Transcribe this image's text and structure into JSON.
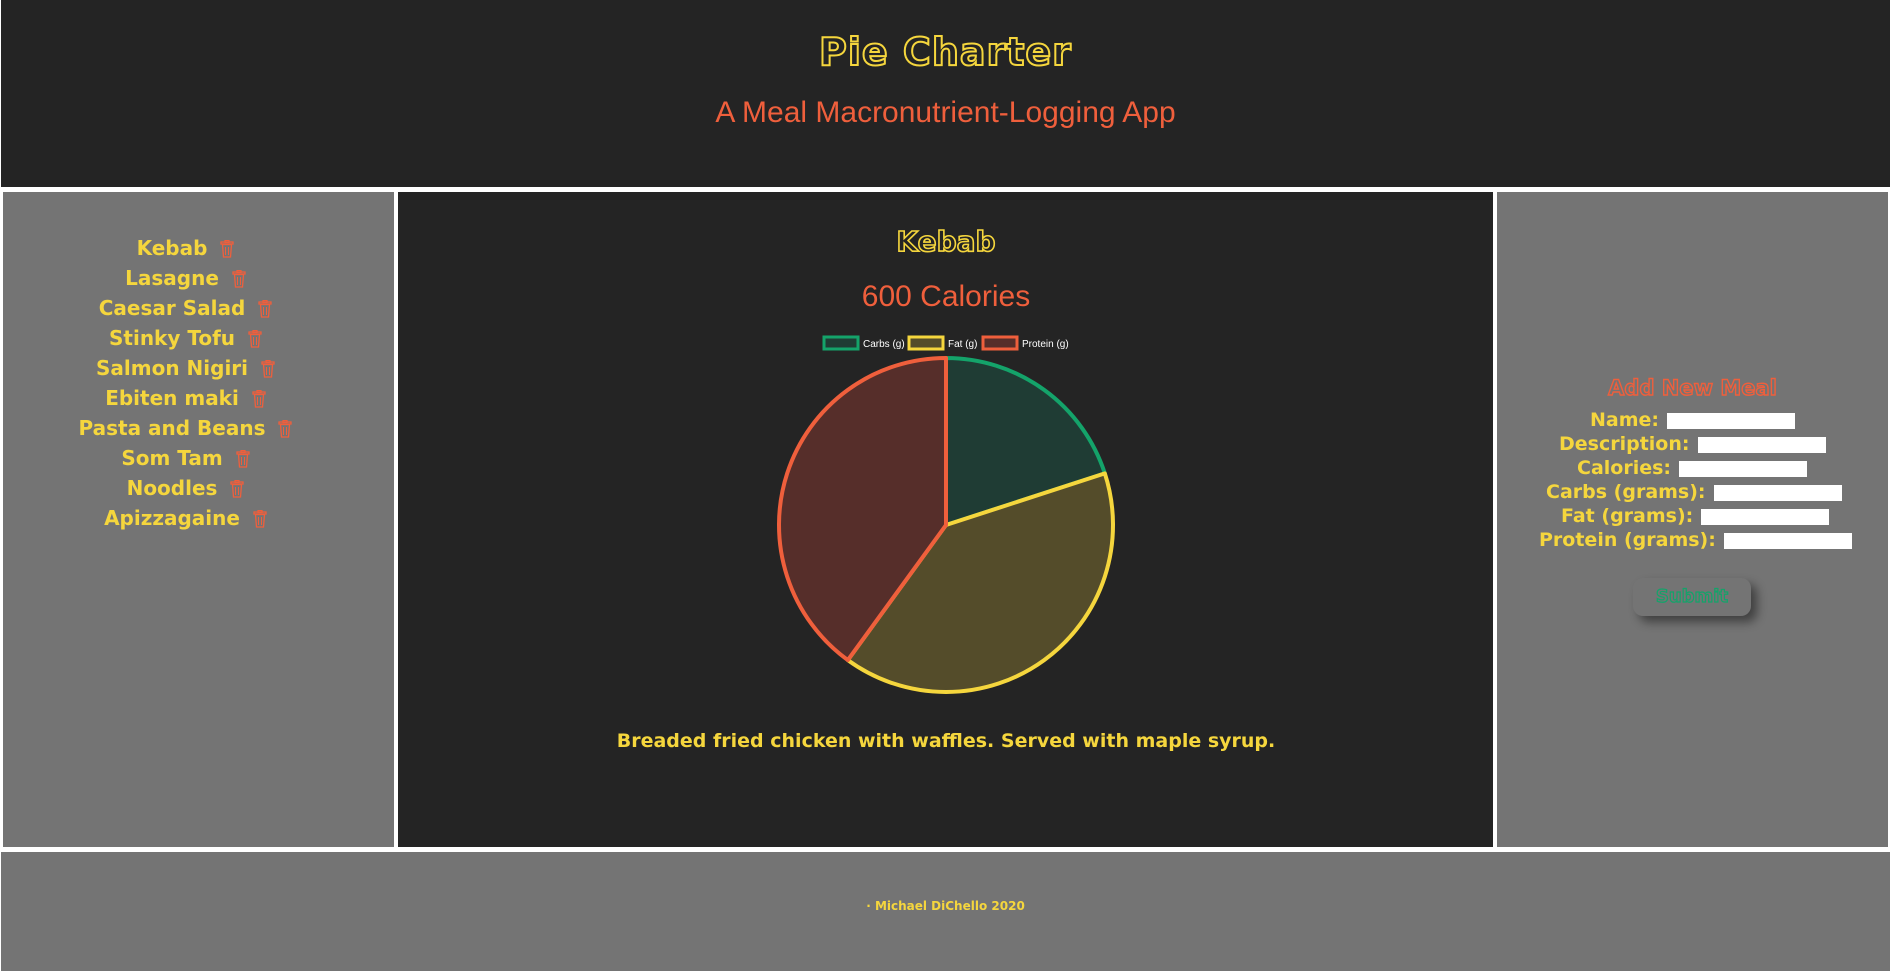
{
  "header": {
    "title": "Pie Charter",
    "subtitle": "A Meal Macronutrient-Logging App"
  },
  "meals": [
    {
      "name": "Kebab"
    },
    {
      "name": "Lasagne"
    },
    {
      "name": "Caesar Salad"
    },
    {
      "name": "Stinky Tofu"
    },
    {
      "name": "Salmon Nigiri"
    },
    {
      "name": "Ebiten maki"
    },
    {
      "name": "Pasta and Beans"
    },
    {
      "name": "Som Tam"
    },
    {
      "name": "Noodles"
    },
    {
      "name": "Apizzagaine"
    }
  ],
  "selected_meal": {
    "name": "Kebab",
    "calories": "600 Calories",
    "description": "Breaded fried chicken with waffles. Served with maple syrup."
  },
  "chart_data": {
    "type": "pie",
    "title": "",
    "legend_position": "top",
    "categories": [
      "Carbs (g)",
      "Fat (g)",
      "Protein (g)"
    ],
    "values": [
      20,
      40,
      40
    ],
    "border_colors": [
      "#14a36a",
      "#f5d63d",
      "#ef5f3c"
    ],
    "fill_colors": [
      "#1f3c34",
      "#544c2a",
      "#562e2a"
    ]
  },
  "form": {
    "title": "Add New Meal",
    "fields": [
      {
        "label": "Name:",
        "value": ""
      },
      {
        "label": "Description:",
        "value": ""
      },
      {
        "label": "Calories:",
        "value": ""
      },
      {
        "label": "Carbs (grams):",
        "value": ""
      },
      {
        "label": "Fat (grams):",
        "value": ""
      },
      {
        "label": "Protein (grams):",
        "value": ""
      }
    ],
    "submit_label": "Submit"
  },
  "footer": {
    "text": "· Michael DiChello 2020"
  },
  "colors": {
    "dark_bg": "#242424",
    "panel_gray": "#747474",
    "yellow": "#f5d63d",
    "orange": "#ef5f3c",
    "green": "#14a36a"
  },
  "icons": {
    "delete": "trash-icon"
  }
}
